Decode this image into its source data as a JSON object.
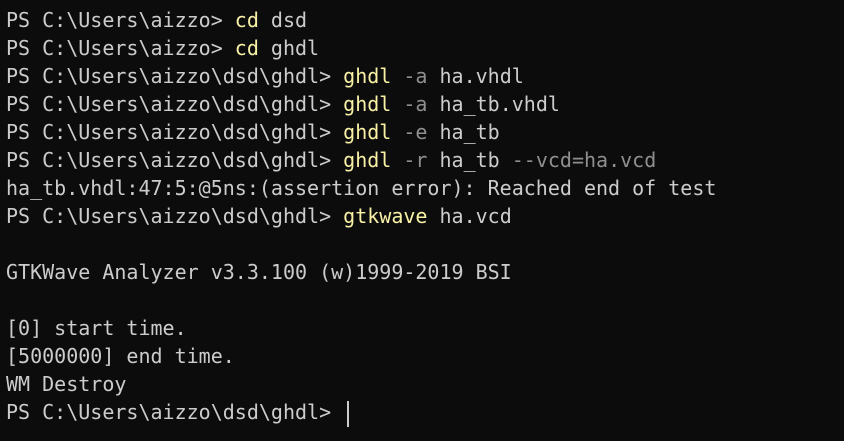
{
  "terminal": {
    "prompt_home": "PS C:\\Users\\aizzo> ",
    "prompt_dsd": "PS C:\\Users\\aizzo\\dsd> ",
    "prompt_ghdl": "PS C:\\Users\\aizzo\\dsd\\ghdl> ",
    "lines": [
      {
        "cmd": "cd",
        "args": " dsd"
      },
      {
        "cmd": "cd",
        "args": " ghdl"
      },
      {
        "cmd": "ghdl",
        "flag": " -a",
        "args": " ha.vhdl"
      },
      {
        "cmd": "ghdl",
        "flag": " -a",
        "args": " ha_tb.vhdl"
      },
      {
        "cmd": "ghdl",
        "flag": " -e",
        "args": " ha_tb"
      },
      {
        "cmd": "ghdl",
        "flag": " -r",
        "args": " ha_tb",
        "extra": " --vcd=ha.vcd"
      },
      {
        "output": "ha_tb.vhdl:47:5:@5ns:(assertion error): Reached end of test"
      },
      {
        "cmd": "gtkwave",
        "args": " ha.vcd"
      },
      {
        "output": "GTKWave Analyzer v3.3.100 (w)1999-2019 BSI"
      },
      {
        "output": "[0] start time."
      },
      {
        "output": "[5000000] end time."
      },
      {
        "output": "WM Destroy"
      }
    ]
  },
  "colors": {
    "background": "#0c0c0c",
    "text": "#cccccc",
    "command": "#f9f1a5",
    "parameter": "#8f8f8f"
  }
}
